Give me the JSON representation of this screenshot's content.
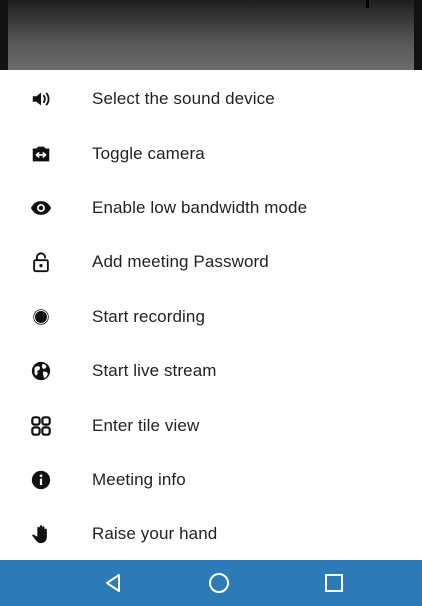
{
  "menu": {
    "items": [
      {
        "label": "Select the sound device",
        "icon": "volume-icon"
      },
      {
        "label": "Toggle camera",
        "icon": "switch-camera-icon"
      },
      {
        "label": "Enable low bandwidth mode",
        "icon": "eye-icon"
      },
      {
        "label": "Add meeting Password",
        "icon": "lock-open-icon"
      },
      {
        "label": "Start recording",
        "icon": "record-icon"
      },
      {
        "label": "Start live stream",
        "icon": "globe-icon"
      },
      {
        "label": "Enter tile view",
        "icon": "tile-view-icon"
      },
      {
        "label": "Meeting info",
        "icon": "info-icon"
      },
      {
        "label": "Raise your hand",
        "icon": "hand-icon"
      }
    ]
  },
  "navbar": {
    "color": "#2c7bb6",
    "buttons": [
      "back-icon",
      "home-icon",
      "recents-icon"
    ]
  }
}
